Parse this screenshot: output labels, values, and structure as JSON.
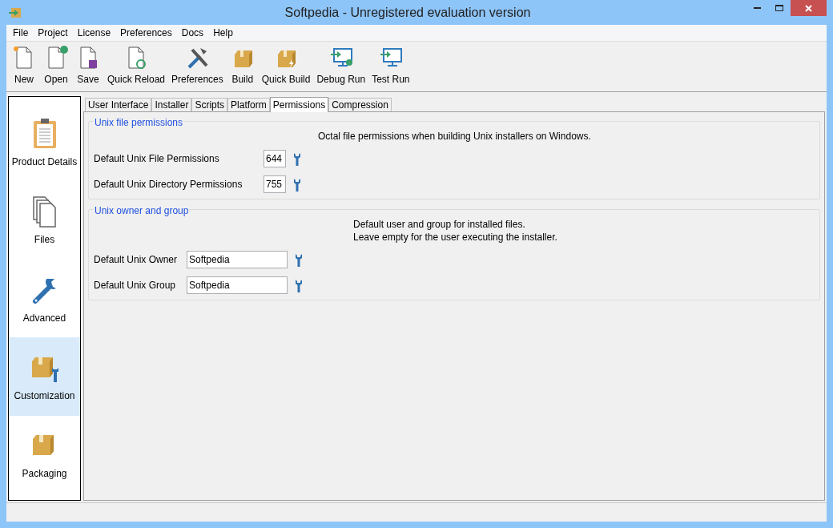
{
  "window": {
    "title": "Softpedia - Unregistered evaluation version"
  },
  "menu": [
    "File",
    "Project",
    "License",
    "Preferences",
    "Docs",
    "Help"
  ],
  "toolbar": [
    {
      "label": "New"
    },
    {
      "label": "Open"
    },
    {
      "label": "Save"
    },
    {
      "label": "Quick Reload"
    },
    {
      "label": "Preferences"
    },
    {
      "label": "Build"
    },
    {
      "label": "Quick Build"
    },
    {
      "label": "Debug Run"
    },
    {
      "label": "Test Run"
    }
  ],
  "sidebar": {
    "items": [
      {
        "label": "Product Details",
        "selected": false
      },
      {
        "label": "Files",
        "selected": false
      },
      {
        "label": "Advanced",
        "selected": false
      },
      {
        "label": "Customization",
        "selected": true
      },
      {
        "label": "Packaging",
        "selected": false
      }
    ]
  },
  "tabs": [
    {
      "label": "User Interface",
      "selected": false
    },
    {
      "label": "Installer",
      "selected": false
    },
    {
      "label": "Scripts",
      "selected": false
    },
    {
      "label": "Platform",
      "selected": false
    },
    {
      "label": "Permissions",
      "selected": true
    },
    {
      "label": "Compression",
      "selected": false
    }
  ],
  "groups": [
    {
      "title": "Unix file permissions",
      "note": [
        "Octal file permissions when building Unix installers on Windows."
      ],
      "fields": [
        {
          "label": "Default Unix File Permissions",
          "value": "644",
          "kind": "octal"
        },
        {
          "label": "Default Unix Directory Permissions",
          "value": "755",
          "kind": "octal"
        }
      ]
    },
    {
      "title": "Unix owner and group",
      "note": [
        "Default user and group for installed files.",
        "Leave empty for the user executing the installer."
      ],
      "fields": [
        {
          "label": "Default Unix Owner",
          "value": "Softpedia",
          "kind": "text"
        },
        {
          "label": "Default Unix Group",
          "value": "Softpedia",
          "kind": "text"
        }
      ]
    }
  ]
}
